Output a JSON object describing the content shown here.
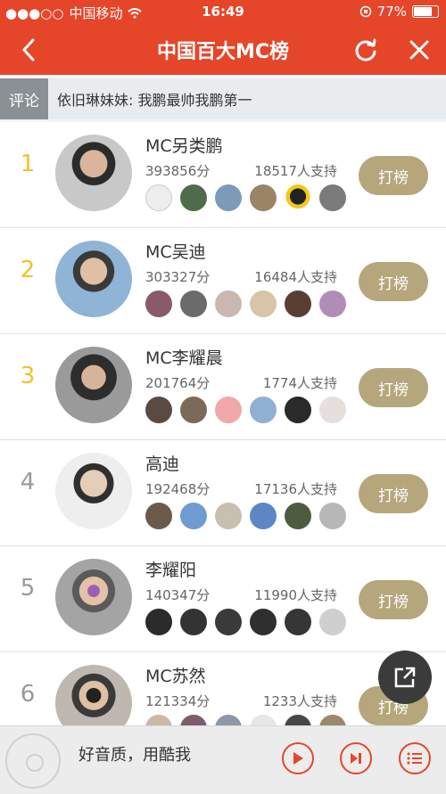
{
  "status_bar": {
    "carrier": "中国移动",
    "time": "16:49",
    "battery": "77%"
  },
  "nav": {
    "title": "中国百大MC榜"
  },
  "comment": {
    "tag": "评论",
    "text": "依旧琳妹妹: 我鹏最帅我鹏第一"
  },
  "vote_label": "打榜",
  "entries": [
    {
      "rank": "1",
      "name": "MC另类鹏",
      "score": "393856分",
      "supporters": "18517人支持"
    },
    {
      "rank": "2",
      "name": "MC吴迪",
      "score": "303327分",
      "supporters": "16484人支持"
    },
    {
      "rank": "3",
      "name": "MC李耀晨",
      "score": "201764分",
      "supporters": "1774人支持"
    },
    {
      "rank": "4",
      "name": "高迪",
      "score": "192468分",
      "supporters": "17136人支持"
    },
    {
      "rank": "5",
      "name": "李耀阳",
      "score": "140347分",
      "supporters": "11990人支持"
    },
    {
      "rank": "6",
      "name": "MC苏然",
      "score": "121334分",
      "supporters": "1233人支持"
    }
  ],
  "player": {
    "text": "好音质，用酷我"
  },
  "colors": {
    "accent": "#e5462a",
    "vote": "#b6a67b",
    "top_rank": "#f2c12e"
  },
  "icons": [
    "back-icon",
    "refresh-icon",
    "close-icon",
    "share-icon",
    "play-icon",
    "next-icon",
    "playlist-icon",
    "disc-icon"
  ]
}
